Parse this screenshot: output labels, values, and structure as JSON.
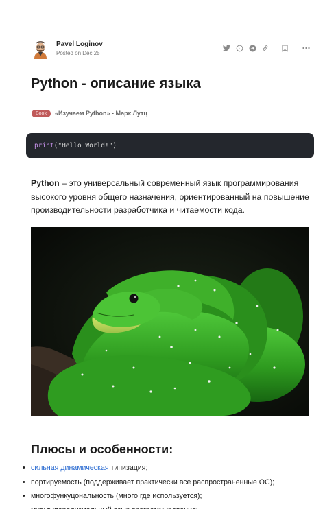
{
  "author": {
    "name": "Pavel Loginov",
    "date": "Posted on Dec 25"
  },
  "actions": [
    "twitter-icon",
    "whatsapp-icon",
    "telegram-icon",
    "link-icon",
    "bookmark-icon",
    "more-icon"
  ],
  "article": {
    "title": "Python - описание языка",
    "badge": "Book",
    "book_ref": "«Изучаем Python» - Марк Лутц",
    "code": {
      "func": "print",
      "open": "(",
      "arg": "\"Hello World!\"",
      "close": ")"
    },
    "intro_bold": "Python",
    "intro_rest": " – это универсальный современный язык программирования высокого уровня общего назначения, ориентированный на повышение производительности разработчика и читаемости кода.",
    "section_title": "Плюсы и особенности:",
    "features": {
      "item1_link1": "сильная",
      "item1_space": " ",
      "item1_link2": "динамическая",
      "item1_rest": " типизация;",
      "item2": "портируемость (поддерживает практически все распространенные ОС);",
      "item3": "многофункуцональность (много где используется);",
      "item4": "мультипарадигмальный язык программирования;"
    }
  },
  "colors": {
    "badge": "#c05a5a",
    "code_bg": "#24272d",
    "keyword": "#c792ea",
    "link": "#2a6bd1",
    "snake": "#3fae2a"
  }
}
